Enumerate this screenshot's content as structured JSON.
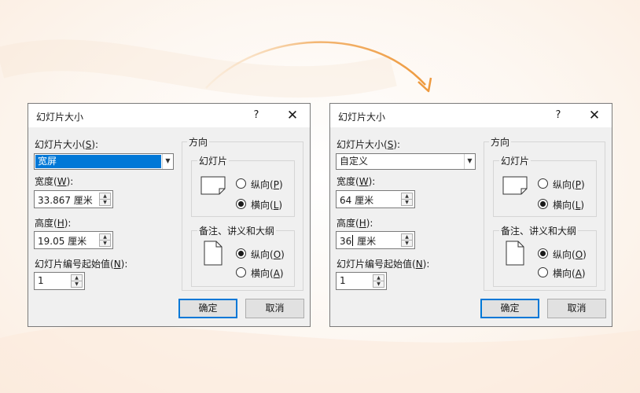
{
  "left_dialog": {
    "title": "幻灯片大小",
    "help": "?",
    "close": "✕",
    "size_label": "幻灯片大小(",
    "size_key": "S",
    "size_tail": "):",
    "size_value": "宽屏",
    "width_label": "宽度(",
    "width_key": "W",
    "width_tail": "):",
    "width_value": "33.867 厘米",
    "height_label": "高度(",
    "height_key": "H",
    "height_tail": "):",
    "height_value": "19.05 厘米",
    "numbering_label": "幻灯片编号起始值(",
    "numbering_key": "N",
    "numbering_tail": "):",
    "numbering_value": "1",
    "orientation_title": "方向",
    "slides_group": "幻灯片",
    "slides_portrait": "纵向(",
    "slides_portrait_key": "P",
    "slides_landscape": "横向(",
    "slides_landscape_key": "L",
    "notes_group": "备注、讲义和大纲",
    "notes_portrait": "纵向(",
    "notes_portrait_key": "O",
    "notes_landscape": "横向(",
    "notes_landscape_key": "A",
    "close_paren": ")",
    "ok": "确定",
    "cancel": "取消"
  },
  "right_dialog": {
    "title": "幻灯片大小",
    "help": "?",
    "close": "✕",
    "size_label": "幻灯片大小(",
    "size_key": "S",
    "size_tail": "):",
    "size_value": "自定义",
    "width_label": "宽度(",
    "width_key": "W",
    "width_tail": "):",
    "width_value": "64 厘米",
    "height_label": "高度(",
    "height_key": "H",
    "height_tail": "):",
    "height_value_a": "36",
    "height_value_b": " 厘米",
    "numbering_label": "幻灯片编号起始值(",
    "numbering_key": "N",
    "numbering_tail": "):",
    "numbering_value": "1",
    "orientation_title": "方向",
    "slides_group": "幻灯片",
    "slides_portrait": "纵向(",
    "slides_portrait_key": "P",
    "slides_landscape": "横向(",
    "slides_landscape_key": "L",
    "notes_group": "备注、讲义和大纲",
    "notes_portrait": "纵向(",
    "notes_portrait_key": "O",
    "notes_landscape": "横向(",
    "notes_landscape_key": "A",
    "close_paren": ")",
    "ok": "确定",
    "cancel": "取消"
  },
  "state": {
    "slides_orientation": "landscape",
    "notes_orientation": "portrait"
  },
  "colors": {
    "accent": "#0078d7",
    "arrow": "#f0a04b",
    "dialog_bg": "#f0f0f0"
  },
  "icons": {
    "help": "help-icon",
    "close": "close-icon",
    "dropdown": "chevron-down-icon",
    "spin_up": "chevron-up-icon",
    "spin_down": "chevron-down-icon",
    "slide_landscape": "landscape-page-icon",
    "slide_portrait": "portrait-page-icon",
    "flow_arrow": "curved-arrow-icon"
  }
}
